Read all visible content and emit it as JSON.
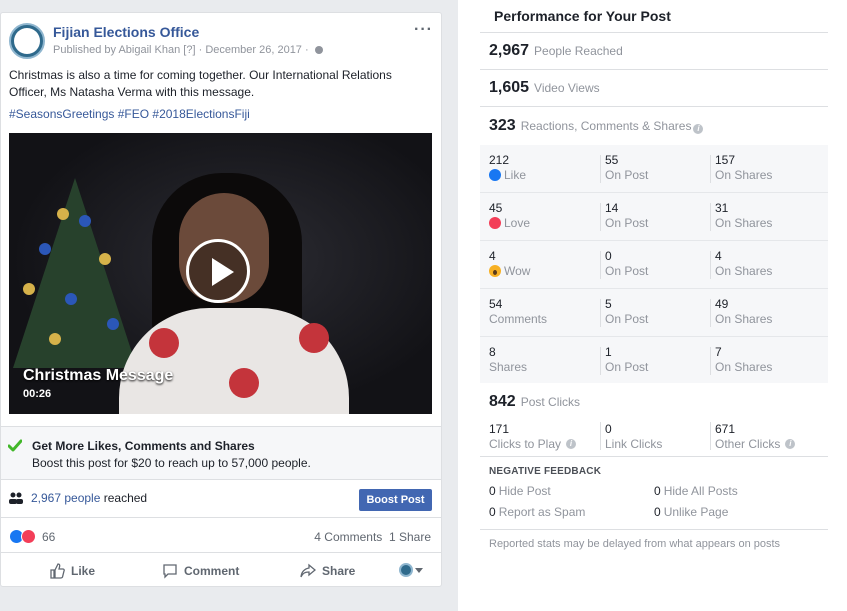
{
  "post": {
    "page_name": "Fijian Elections Office",
    "published_by_prefix": "Published by",
    "published_by": "Abigail Khan",
    "help_marker": "[?]",
    "date": "December 26, 2017",
    "more_label": "···",
    "text": "Christmas is also a time for coming together. Our International Relations Officer, Ms Natasha Verma with this message.",
    "hashtags": "#SeasonsGreetings #FEO #2018ElectionsFiji",
    "video": {
      "title": "Christmas Message",
      "duration": "00:26"
    },
    "promo": {
      "title": "Get More Likes, Comments and Shares",
      "subtitle": "Boost this post for $20 to reach up to 57,000 people."
    },
    "reach": {
      "count_link": "2,967 people",
      "suffix": " reached",
      "boost_label": "Boost Post"
    },
    "reactions": {
      "count": "66",
      "comments": "4 Comments",
      "shares": "1 Share"
    },
    "actions": {
      "like": "Like",
      "comment": "Comment",
      "share": "Share"
    }
  },
  "panel": {
    "title": "Performance for Your Post",
    "people_reached": {
      "value": "2,967",
      "label": "People Reached"
    },
    "video_views": {
      "value": "1,605",
      "label": "Video Views"
    },
    "engagement": {
      "value": "323",
      "label": "Reactions, Comments & Shares"
    },
    "breakdown": [
      {
        "total": "212",
        "label": "Like",
        "on_post": "55",
        "on_post_label": "On Post",
        "on_shares": "157",
        "on_shares_label": "On Shares"
      },
      {
        "total": "45",
        "label": "Love",
        "on_post": "14",
        "on_post_label": "On Post",
        "on_shares": "31",
        "on_shares_label": "On Shares"
      },
      {
        "total": "4",
        "label": "Wow",
        "on_post": "0",
        "on_post_label": "On Post",
        "on_shares": "4",
        "on_shares_label": "On Shares"
      },
      {
        "total": "54",
        "label": "Comments",
        "on_post": "5",
        "on_post_label": "On Post",
        "on_shares": "49",
        "on_shares_label": "On Shares"
      },
      {
        "total": "8",
        "label": "Shares",
        "on_post": "1",
        "on_post_label": "On Post",
        "on_shares": "7",
        "on_shares_label": "On Shares"
      }
    ],
    "post_clicks": {
      "value": "842",
      "label": "Post Clicks"
    },
    "clicks": [
      {
        "value": "171",
        "label": "Clicks to Play"
      },
      {
        "value": "0",
        "label": "Link Clicks"
      },
      {
        "value": "671",
        "label": "Other Clicks"
      }
    ],
    "negative": {
      "title": "NEGATIVE FEEDBACK",
      "hide_post": {
        "value": "0",
        "label": "Hide Post"
      },
      "hide_all": {
        "value": "0",
        "label": "Hide All Posts"
      },
      "spam": {
        "value": "0",
        "label": "Report as Spam"
      },
      "unlike": {
        "value": "0",
        "label": "Unlike Page"
      }
    },
    "footnote": "Reported stats may be delayed from what appears on posts"
  }
}
